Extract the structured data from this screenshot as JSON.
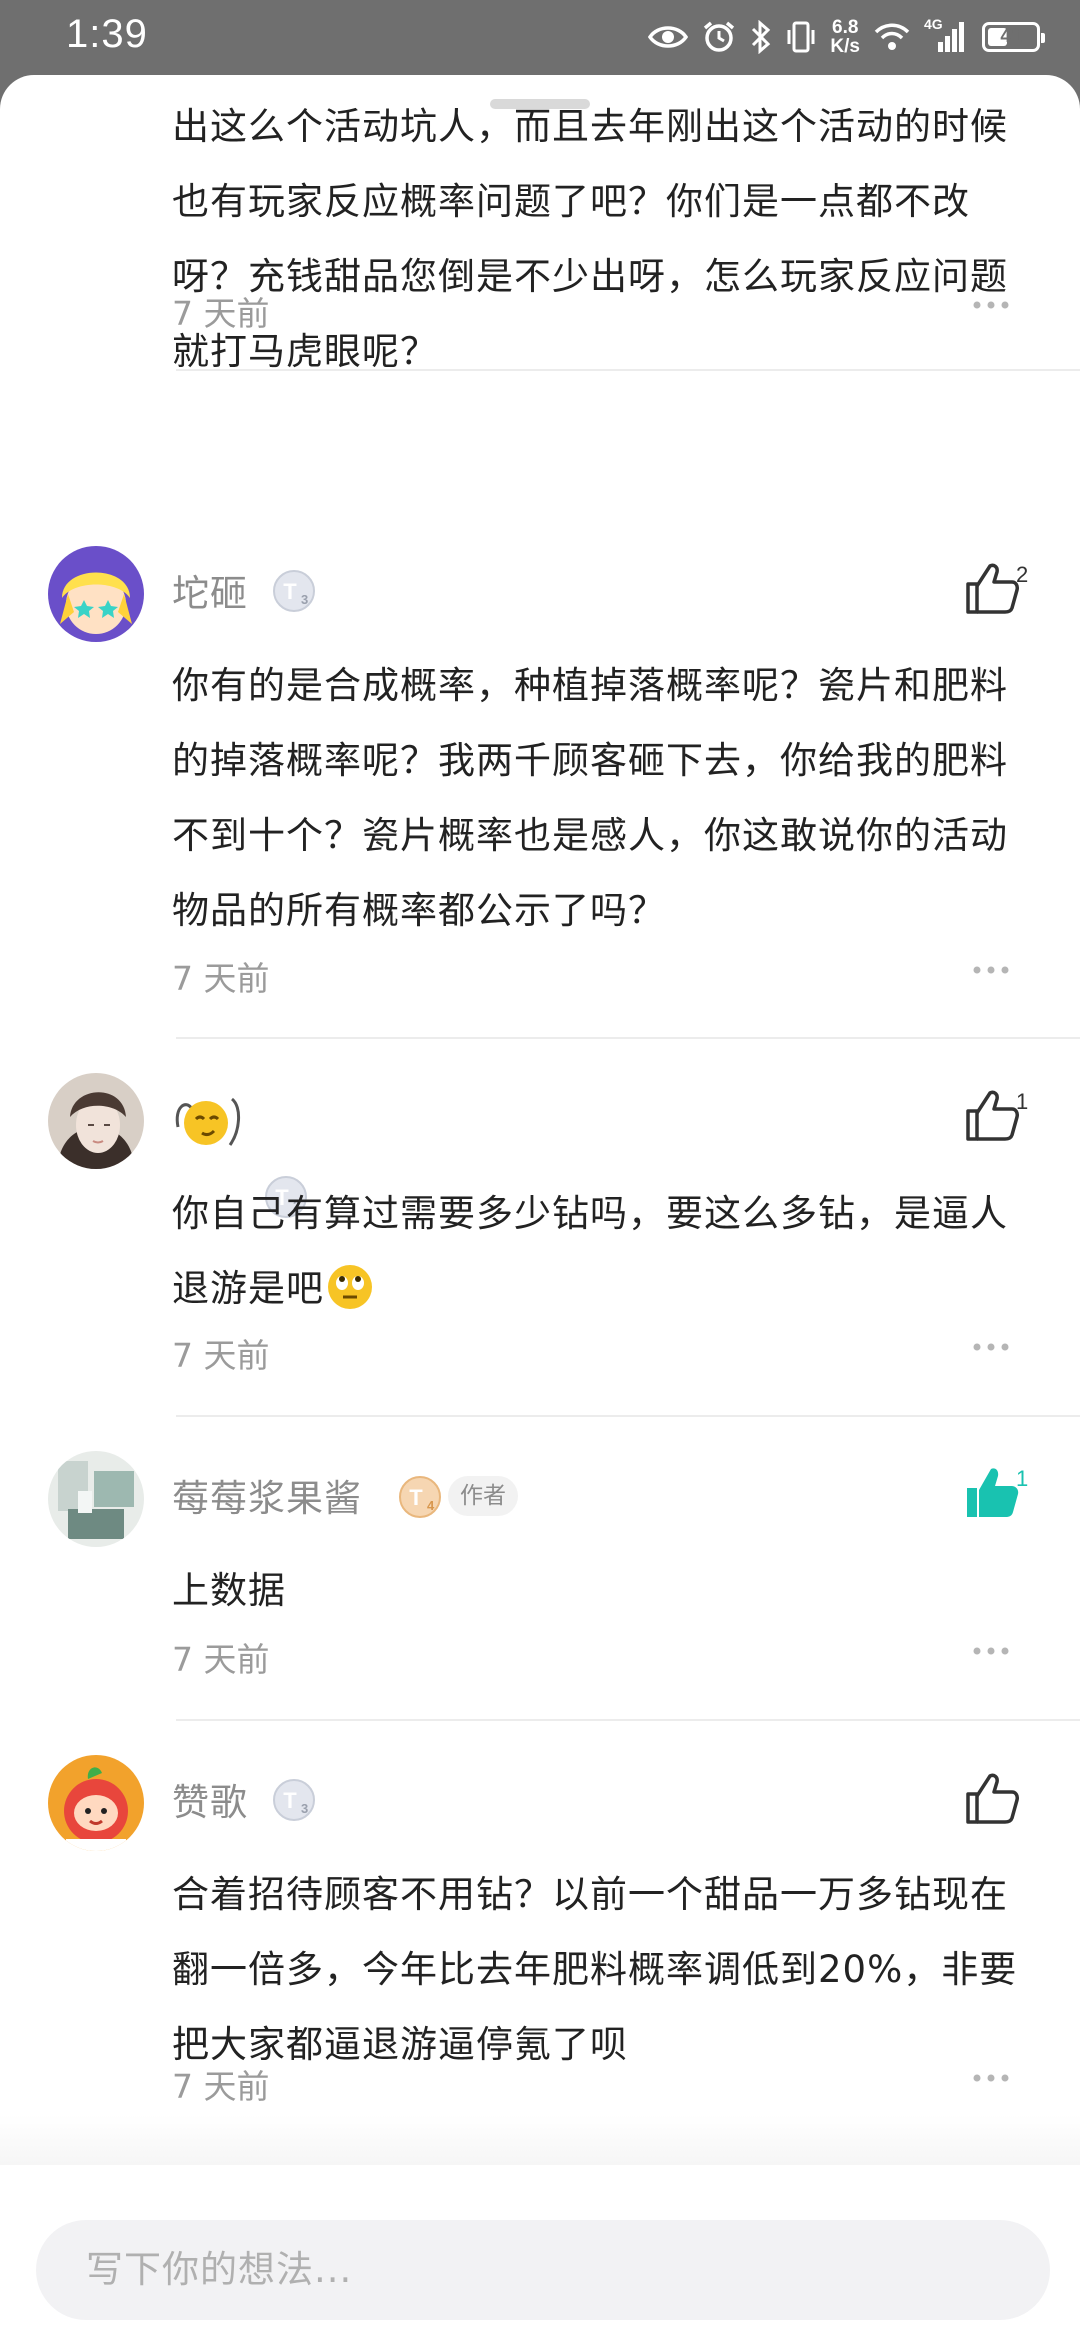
{
  "status_bar": {
    "time": "1:39",
    "net_speed_value": "6.8",
    "net_speed_unit": "K/s",
    "network_type": "4G",
    "battery": "41",
    "battery_fraction": 0.41
  },
  "comments": [
    {
      "text": "出这么个活动坑人，而且去年刚出这个活动的时候也有玩家反应概率问题了吧？你们是一点都不改呀？充钱甜品您倒是不少出呀，怎么玩家反应问题就打马虎眼呢？",
      "time": "7 天前"
    },
    {
      "username": "坨砸",
      "level": "3",
      "likes": "2",
      "text": "你有的是合成概率，种植掉落概率呢？瓷片和肥料的掉落概率呢？我两千顾客砸下去，你给我的肥料不到十个？瓷片概率也是感人，你这敢说你的活动物品的所有概率都公示了吗？",
      "time": "7 天前"
    },
    {
      "username": "",
      "level": "2",
      "likes": "1",
      "text": "你自己有算过需要多少钻吗，要这么多钻，是逼人退游是吧",
      "time": "7 天前"
    },
    {
      "username": "莓莓浆果酱",
      "level": "4",
      "author_tag": "作者",
      "likes": "1",
      "liked": true,
      "text": "上数据",
      "time": "7 天前"
    },
    {
      "username": "赞歌",
      "level": "3",
      "likes": "",
      "text": "合着招待顾客不用钻？以前一个甜品一万多钻现在翻一倍多，今年比去年肥料概率调低到20%，非要把大家都逼退游逼停氪了呗",
      "time": "7 天前"
    }
  ],
  "input": {
    "placeholder": "写下你的想法..."
  },
  "colors": {
    "accent": "#19c2b0",
    "text": "#222222",
    "muted": "#9b9b9b"
  },
  "icons": [
    "eye-icon",
    "alarm-icon",
    "bluetooth-icon",
    "vibrate-icon",
    "wifi-icon",
    "signal-icon",
    "battery-icon",
    "thumbs-up-icon",
    "more-icon"
  ]
}
